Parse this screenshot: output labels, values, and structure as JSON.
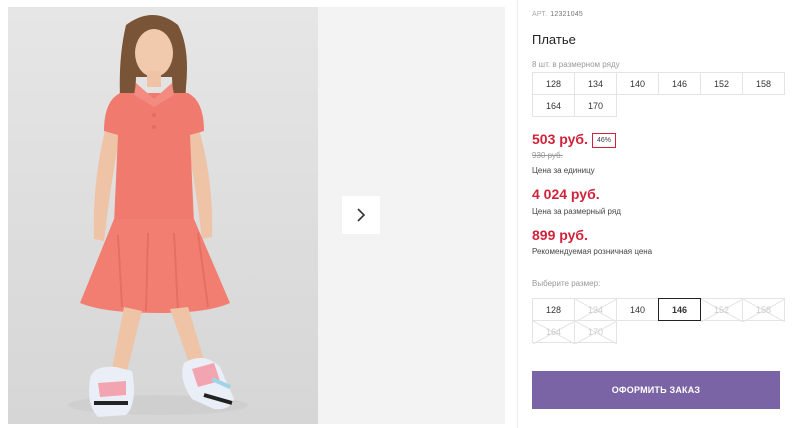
{
  "product": {
    "article_label": "АРТ.",
    "article": "12321045",
    "title": "Платье"
  },
  "gallery": {
    "next_icon": "chevron-right-icon"
  },
  "size_row": {
    "hint": "8 шт. в размерном ряду",
    "sizes": [
      "128",
      "134",
      "140",
      "146",
      "152",
      "158",
      "164",
      "170"
    ]
  },
  "pricing": {
    "unit_price": "503 руб.",
    "discount": "46%",
    "old_price": "930 руб.",
    "unit_note": "Цена за единицу",
    "row_price": "4 024 руб.",
    "row_note": "Цена за размерный ряд",
    "retail_price": "899 руб.",
    "retail_note": "Рекомендуемая розничная цена"
  },
  "size_select": {
    "label": "Выберите размер:",
    "sizes": [
      {
        "label": "128",
        "available": true,
        "selected": false
      },
      {
        "label": "134",
        "available": false,
        "selected": false
      },
      {
        "label": "140",
        "available": true,
        "selected": false
      },
      {
        "label": "146",
        "available": true,
        "selected": true
      },
      {
        "label": "152",
        "available": false,
        "selected": false
      },
      {
        "label": "158",
        "available": false,
        "selected": false
      },
      {
        "label": "164",
        "available": false,
        "selected": false
      },
      {
        "label": "170",
        "available": false,
        "selected": false
      }
    ]
  },
  "actions": {
    "order_label": "ОФОРМИТЬ ЗАКАЗ"
  },
  "colors": {
    "accent": "#7b64a5",
    "price": "#d0233b",
    "dress": "#f07a6e"
  }
}
